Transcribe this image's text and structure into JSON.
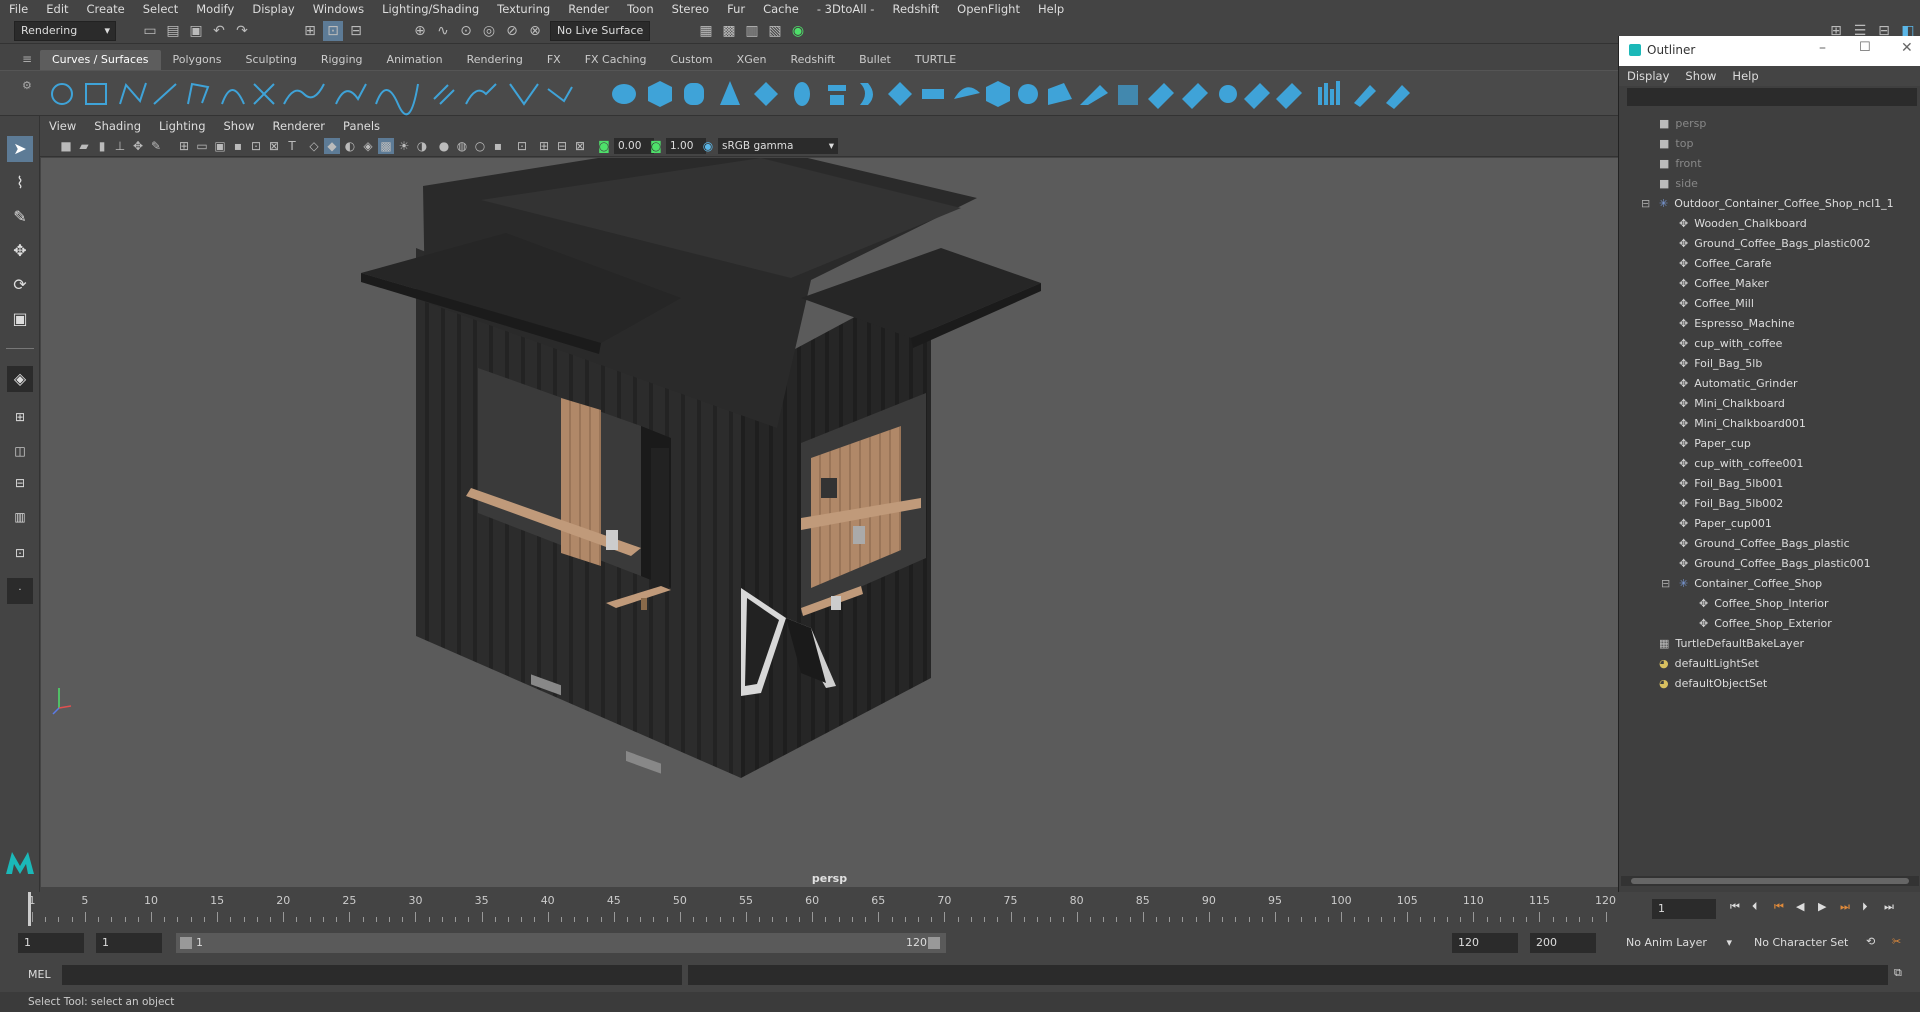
{
  "menubar": [
    "File",
    "Edit",
    "Create",
    "Select",
    "Modify",
    "Display",
    "Windows",
    "Lighting/Shading",
    "Texturing",
    "Render",
    "Toon",
    "Stereo",
    "Fur",
    "Cache",
    "- 3DtoAll -",
    "Redshift",
    "OpenFlight",
    "Help"
  ],
  "status_line": {
    "mode": "Rendering",
    "live_surface": "No Live Surface"
  },
  "shelf_tabs": [
    "Curves / Surfaces",
    "Polygons",
    "Sculpting",
    "Rigging",
    "Animation",
    "Rendering",
    "FX",
    "FX Caching",
    "Custom",
    "XGen",
    "Redshift",
    "Bullet",
    "TURTLE"
  ],
  "shelf_active": "Curves / Surfaces",
  "viewport": {
    "menu": [
      "View",
      "Shading",
      "Lighting",
      "Show",
      "Renderer",
      "Panels"
    ],
    "exposure": "0.00",
    "gamma": "1.00",
    "color_space": "sRGB gamma",
    "camera_label": "persp"
  },
  "outliner": {
    "title": "Outliner",
    "menu": [
      "Display",
      "Show",
      "Help"
    ],
    "items": [
      {
        "label": "persp",
        "kind": "camera",
        "depth": 0,
        "dim": true
      },
      {
        "label": "top",
        "kind": "camera",
        "depth": 0,
        "dim": true
      },
      {
        "label": "front",
        "kind": "camera",
        "depth": 0,
        "dim": true
      },
      {
        "label": "side",
        "kind": "camera",
        "depth": 0,
        "dim": true
      },
      {
        "label": "Outdoor_Container_Coffee_Shop_ncl1_1",
        "kind": "group",
        "depth": 0
      },
      {
        "label": "Wooden_Chalkboard",
        "kind": "mesh",
        "depth": 1
      },
      {
        "label": "Ground_Coffee_Bags_plastic002",
        "kind": "mesh",
        "depth": 1
      },
      {
        "label": "Coffee_Carafe",
        "kind": "mesh",
        "depth": 1
      },
      {
        "label": "Coffee_Maker",
        "kind": "mesh",
        "depth": 1
      },
      {
        "label": "Coffee_Mill",
        "kind": "mesh",
        "depth": 1
      },
      {
        "label": "Espresso_Machine",
        "kind": "mesh",
        "depth": 1
      },
      {
        "label": "cup_with_coffee",
        "kind": "mesh",
        "depth": 1
      },
      {
        "label": "Foil_Bag_5lb",
        "kind": "mesh",
        "depth": 1
      },
      {
        "label": "Automatic_Grinder",
        "kind": "mesh",
        "depth": 1
      },
      {
        "label": "Mini_Chalkboard",
        "kind": "mesh",
        "depth": 1
      },
      {
        "label": "Mini_Chalkboard001",
        "kind": "mesh",
        "depth": 1
      },
      {
        "label": "Paper_cup",
        "kind": "mesh",
        "depth": 1
      },
      {
        "label": "cup_with_coffee001",
        "kind": "mesh",
        "depth": 1
      },
      {
        "label": "Foil_Bag_5lb001",
        "kind": "mesh",
        "depth": 1
      },
      {
        "label": "Foil_Bag_5lb002",
        "kind": "mesh",
        "depth": 1
      },
      {
        "label": "Paper_cup001",
        "kind": "mesh",
        "depth": 1
      },
      {
        "label": "Ground_Coffee_Bags_plastic",
        "kind": "mesh",
        "depth": 1
      },
      {
        "label": "Ground_Coffee_Bags_plastic001",
        "kind": "mesh",
        "depth": 1
      },
      {
        "label": "Container_Coffee_Shop",
        "kind": "group",
        "depth": 1
      },
      {
        "label": "Coffee_Shop_Interior",
        "kind": "mesh",
        "depth": 2
      },
      {
        "label": "Coffee_Shop_Exterior",
        "kind": "mesh",
        "depth": 2
      },
      {
        "label": "TurtleDefaultBakeLayer",
        "kind": "layer",
        "depth": 0
      },
      {
        "label": "defaultLightSet",
        "kind": "set",
        "depth": 0
      },
      {
        "label": "defaultObjectSet",
        "kind": "set",
        "depth": 0
      }
    ]
  },
  "timeline": {
    "ticks": [
      "1",
      "5",
      "10",
      "15",
      "20",
      "25",
      "30",
      "35",
      "40",
      "45",
      "50",
      "55",
      "60",
      "65",
      "70",
      "75",
      "80",
      "85",
      "90",
      "95",
      "100",
      "105",
      "110",
      "115",
      "120"
    ],
    "current_frame": "1"
  },
  "range": {
    "start": "1",
    "playback_start": "1",
    "slider_start": "1",
    "slider_end": "120",
    "playback_end": "120",
    "end": "200",
    "anim_layer": "No Anim Layer",
    "character_set": "No Character Set"
  },
  "command_line": {
    "lang": "MEL"
  },
  "help_line": "Select Tool: select an object",
  "colors": {
    "shelf_icon": "#3fa3d8",
    "accent": "#5bb7e8",
    "wood": "#b08868",
    "container": "#2e2e2e",
    "viewport_bg": "#5b5b5b"
  }
}
